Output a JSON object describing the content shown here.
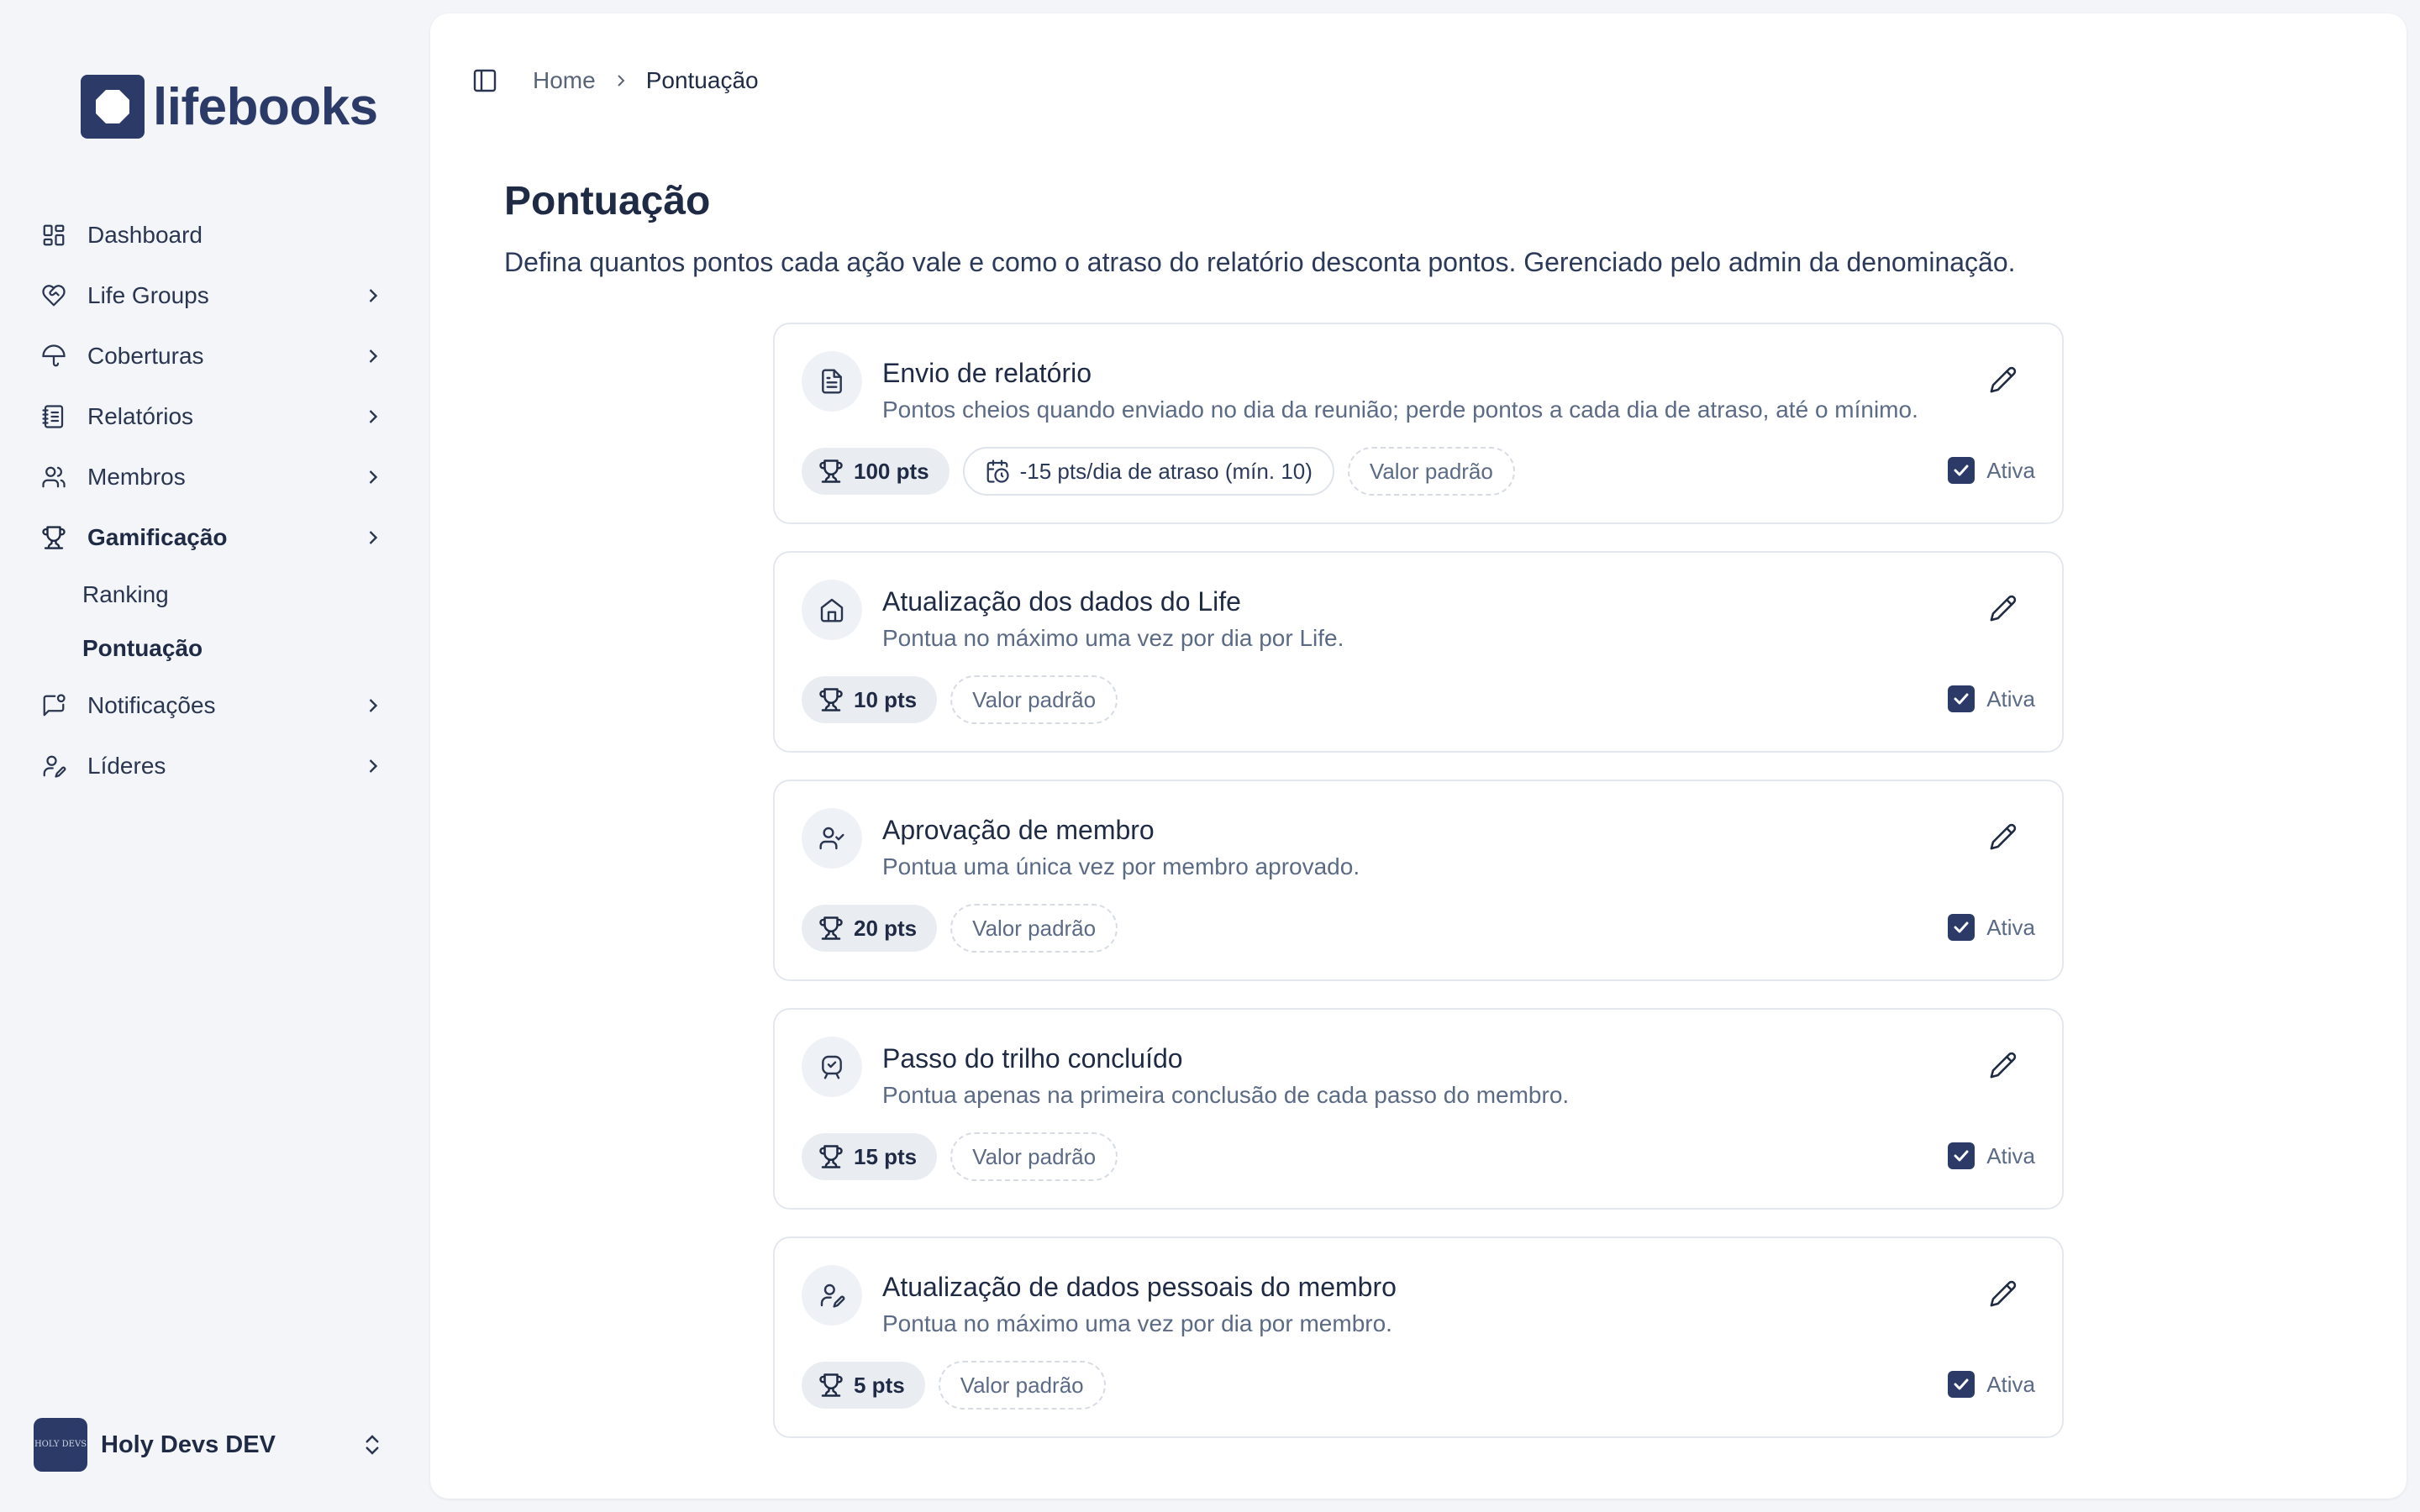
{
  "brand": {
    "name": "lifebooks",
    "color": "#2b3a67"
  },
  "sidebar": {
    "items": [
      {
        "label": "Dashboard",
        "icon": "dashboard-icon",
        "chevron": false
      },
      {
        "label": "Life Groups",
        "icon": "heart-handshake-icon",
        "chevron": true
      },
      {
        "label": "Coberturas",
        "icon": "umbrella-icon",
        "chevron": true
      },
      {
        "label": "Relatórios",
        "icon": "notebook-icon",
        "chevron": true
      },
      {
        "label": "Membros",
        "icon": "users-icon",
        "chevron": true
      },
      {
        "label": "Gamificação",
        "icon": "trophy-icon",
        "chevron": true,
        "active": true
      },
      {
        "label": "Notificações",
        "icon": "message-bell-icon",
        "chevron": true
      },
      {
        "label": "Líderes",
        "icon": "user-pen-icon",
        "chevron": true
      }
    ],
    "subitems": [
      {
        "label": "Ranking"
      },
      {
        "label": "Pontuação",
        "active": true
      }
    ],
    "workspace": {
      "name": "Holy Devs DEV",
      "avatar_text": "HOLY DEVS"
    }
  },
  "breadcrumb": {
    "home": "Home",
    "current": "Pontuação"
  },
  "page": {
    "title": "Pontuação",
    "description": "Defina quantos pontos cada ação vale e como o atraso do relatório desconta pontos. Gerenciado pelo admin da denominação."
  },
  "rules": [
    {
      "icon": "file-text-icon",
      "title": "Envio de relatório",
      "description": "Pontos cheios quando enviado no dia da reunião; perde pontos a cada dia de atraso, até o mínimo.",
      "points": "100 pts",
      "late": "-15 pts/dia de atraso (mín. 10)",
      "default_label": "Valor padrão",
      "active_label": "Ativa",
      "active": true
    },
    {
      "icon": "home-icon",
      "title": "Atualização dos dados do Life",
      "description": "Pontua no máximo uma vez por dia por Life.",
      "points": "10 pts",
      "late": "",
      "default_label": "Valor padrão",
      "active_label": "Ativa",
      "active": true
    },
    {
      "icon": "user-check-icon",
      "title": "Aprovação de membro",
      "description": "Pontua uma única vez por membro aprovado.",
      "points": "20 pts",
      "late": "",
      "default_label": "Valor padrão",
      "active_label": "Ativa",
      "active": true
    },
    {
      "icon": "badge-check-icon",
      "title": "Passo do trilho concluído",
      "description": "Pontua apenas na primeira conclusão de cada passo do membro.",
      "points": "15 pts",
      "late": "",
      "default_label": "Valor padrão",
      "active_label": "Ativa",
      "active": true
    },
    {
      "icon": "user-pen-icon",
      "title": "Atualização de dados pessoais do membro",
      "description": "Pontua no máximo uma vez por dia por membro.",
      "points": "5 pts",
      "late": "",
      "default_label": "Valor padrão",
      "active_label": "Ativa",
      "active": true
    }
  ]
}
